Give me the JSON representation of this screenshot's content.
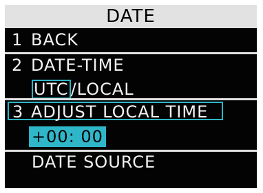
{
  "header": {
    "title": "DATE"
  },
  "menu": {
    "back": {
      "number": "1",
      "label": "BACK"
    },
    "date_time": {
      "number": "2",
      "label": "DATE-TIME"
    },
    "time_base": {
      "selected": "UTC",
      "separator": "/",
      "other": "LOCAL"
    },
    "adjust_local_time": {
      "number": "3",
      "label": "ADJUST LOCAL TIME"
    },
    "offset_value": "+00: 00",
    "date_source": {
      "label": "DATE SOURCE"
    }
  },
  "colors": {
    "background": "#030303",
    "title_bar": "#e2e2e2",
    "text": "#f2f2f2",
    "highlight": "#2fb6c8"
  }
}
